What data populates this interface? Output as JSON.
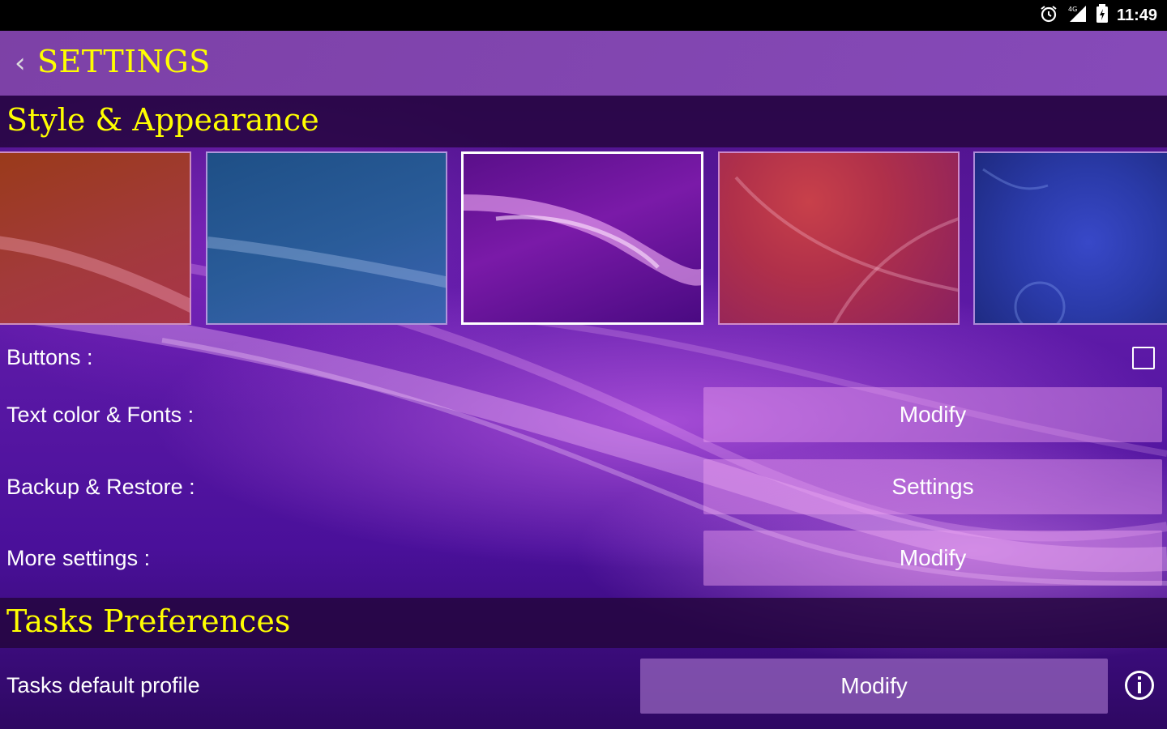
{
  "status_bar": {
    "time": "11:49",
    "icons": [
      "alarm-icon",
      "signal-icon",
      "battery-icon"
    ]
  },
  "app_bar": {
    "title": "SETTINGS",
    "back_icon": "chevron-left-icon"
  },
  "sections": {
    "style": {
      "title": "Style & Appearance"
    },
    "tasks": {
      "title": "Tasks Preferences"
    }
  },
  "themes": [
    {
      "name": "orange-theme",
      "selected": false
    },
    {
      "name": "blue-theme",
      "selected": false
    },
    {
      "name": "purple-theme",
      "selected": true
    },
    {
      "name": "red-theme",
      "selected": false
    },
    {
      "name": "dark-blue-theme",
      "selected": false
    }
  ],
  "rows": {
    "buttons": {
      "label": "Buttons :",
      "checked": false
    },
    "text_color": {
      "label": "Text color & Fonts :",
      "button": "Modify"
    },
    "backup": {
      "label": "Backup & Restore :",
      "button": "Settings"
    },
    "more": {
      "label": "More settings :",
      "button": "Modify"
    },
    "tasks_profile": {
      "label": "Tasks default profile",
      "button": "Modify",
      "icon": "info-icon"
    }
  },
  "colors": {
    "title_yellow": "#ffff00",
    "accent_purple": "#5e1aa8"
  }
}
